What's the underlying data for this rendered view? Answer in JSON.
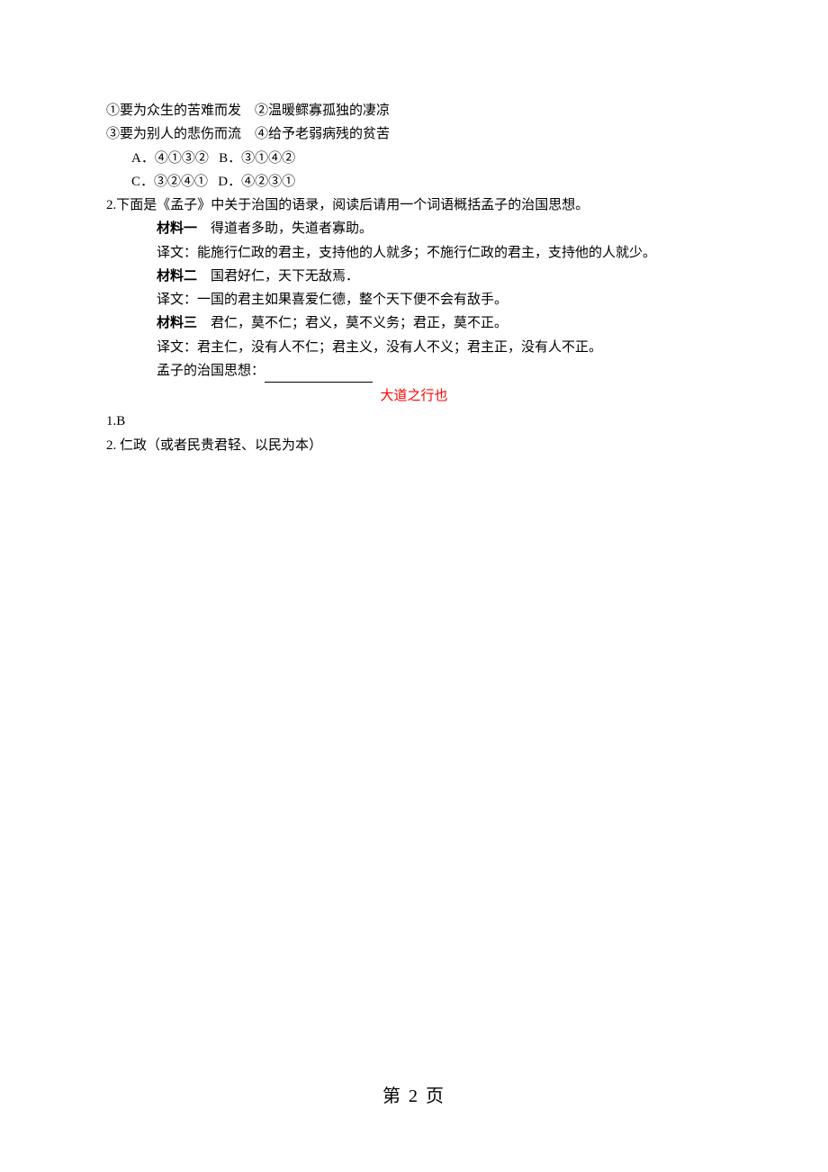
{
  "q1": {
    "line1": "①要为众生的苦难而发　②温暖鳏寡孤独的凄凉",
    "line2": "③要为别人的悲伤而流　④给予老弱病残的贫苦",
    "optA_label": "A．",
    "optA_text": "④①③②",
    "optB_label": "B．",
    "optB_text": "③①④②",
    "optC_label": "C．",
    "optC_text": "③②④①",
    "optD_label": "D．",
    "optD_text": "④②③①"
  },
  "q2": {
    "prompt": "2.下面是《孟子》中关于治国的语录，阅读后请用一个词语概括孟子的治国思想。",
    "m1_label": "材料一",
    "m1_text": "　得道者多助，失道者寡助。",
    "m1_trans": "译文：能施行仁政的君主，支持他的人就多；不施行仁政的君主，支持他的人就少。",
    "m2_label": "材料二",
    "m2_text": "　国君好仁，天下无敌焉．",
    "m2_trans": "译文：一国的君主如果喜爱仁德，整个天下便不会有敌手。",
    "m3_label": "材料三",
    "m3_text": "　君仁，莫不仁；君义，莫不义务；君正，莫不正。",
    "m3_trans": "译文：君主仁，没有人不仁；君主义，没有人不义；君主正，没有人不正。",
    "conclusion": "孟子的治国思想："
  },
  "answer_title": "大道之行也",
  "answers": {
    "a1": "1.B",
    "a2": "2. 仁政（或者民贵君轻、以民为本）"
  },
  "page_footer": "第 2 页"
}
